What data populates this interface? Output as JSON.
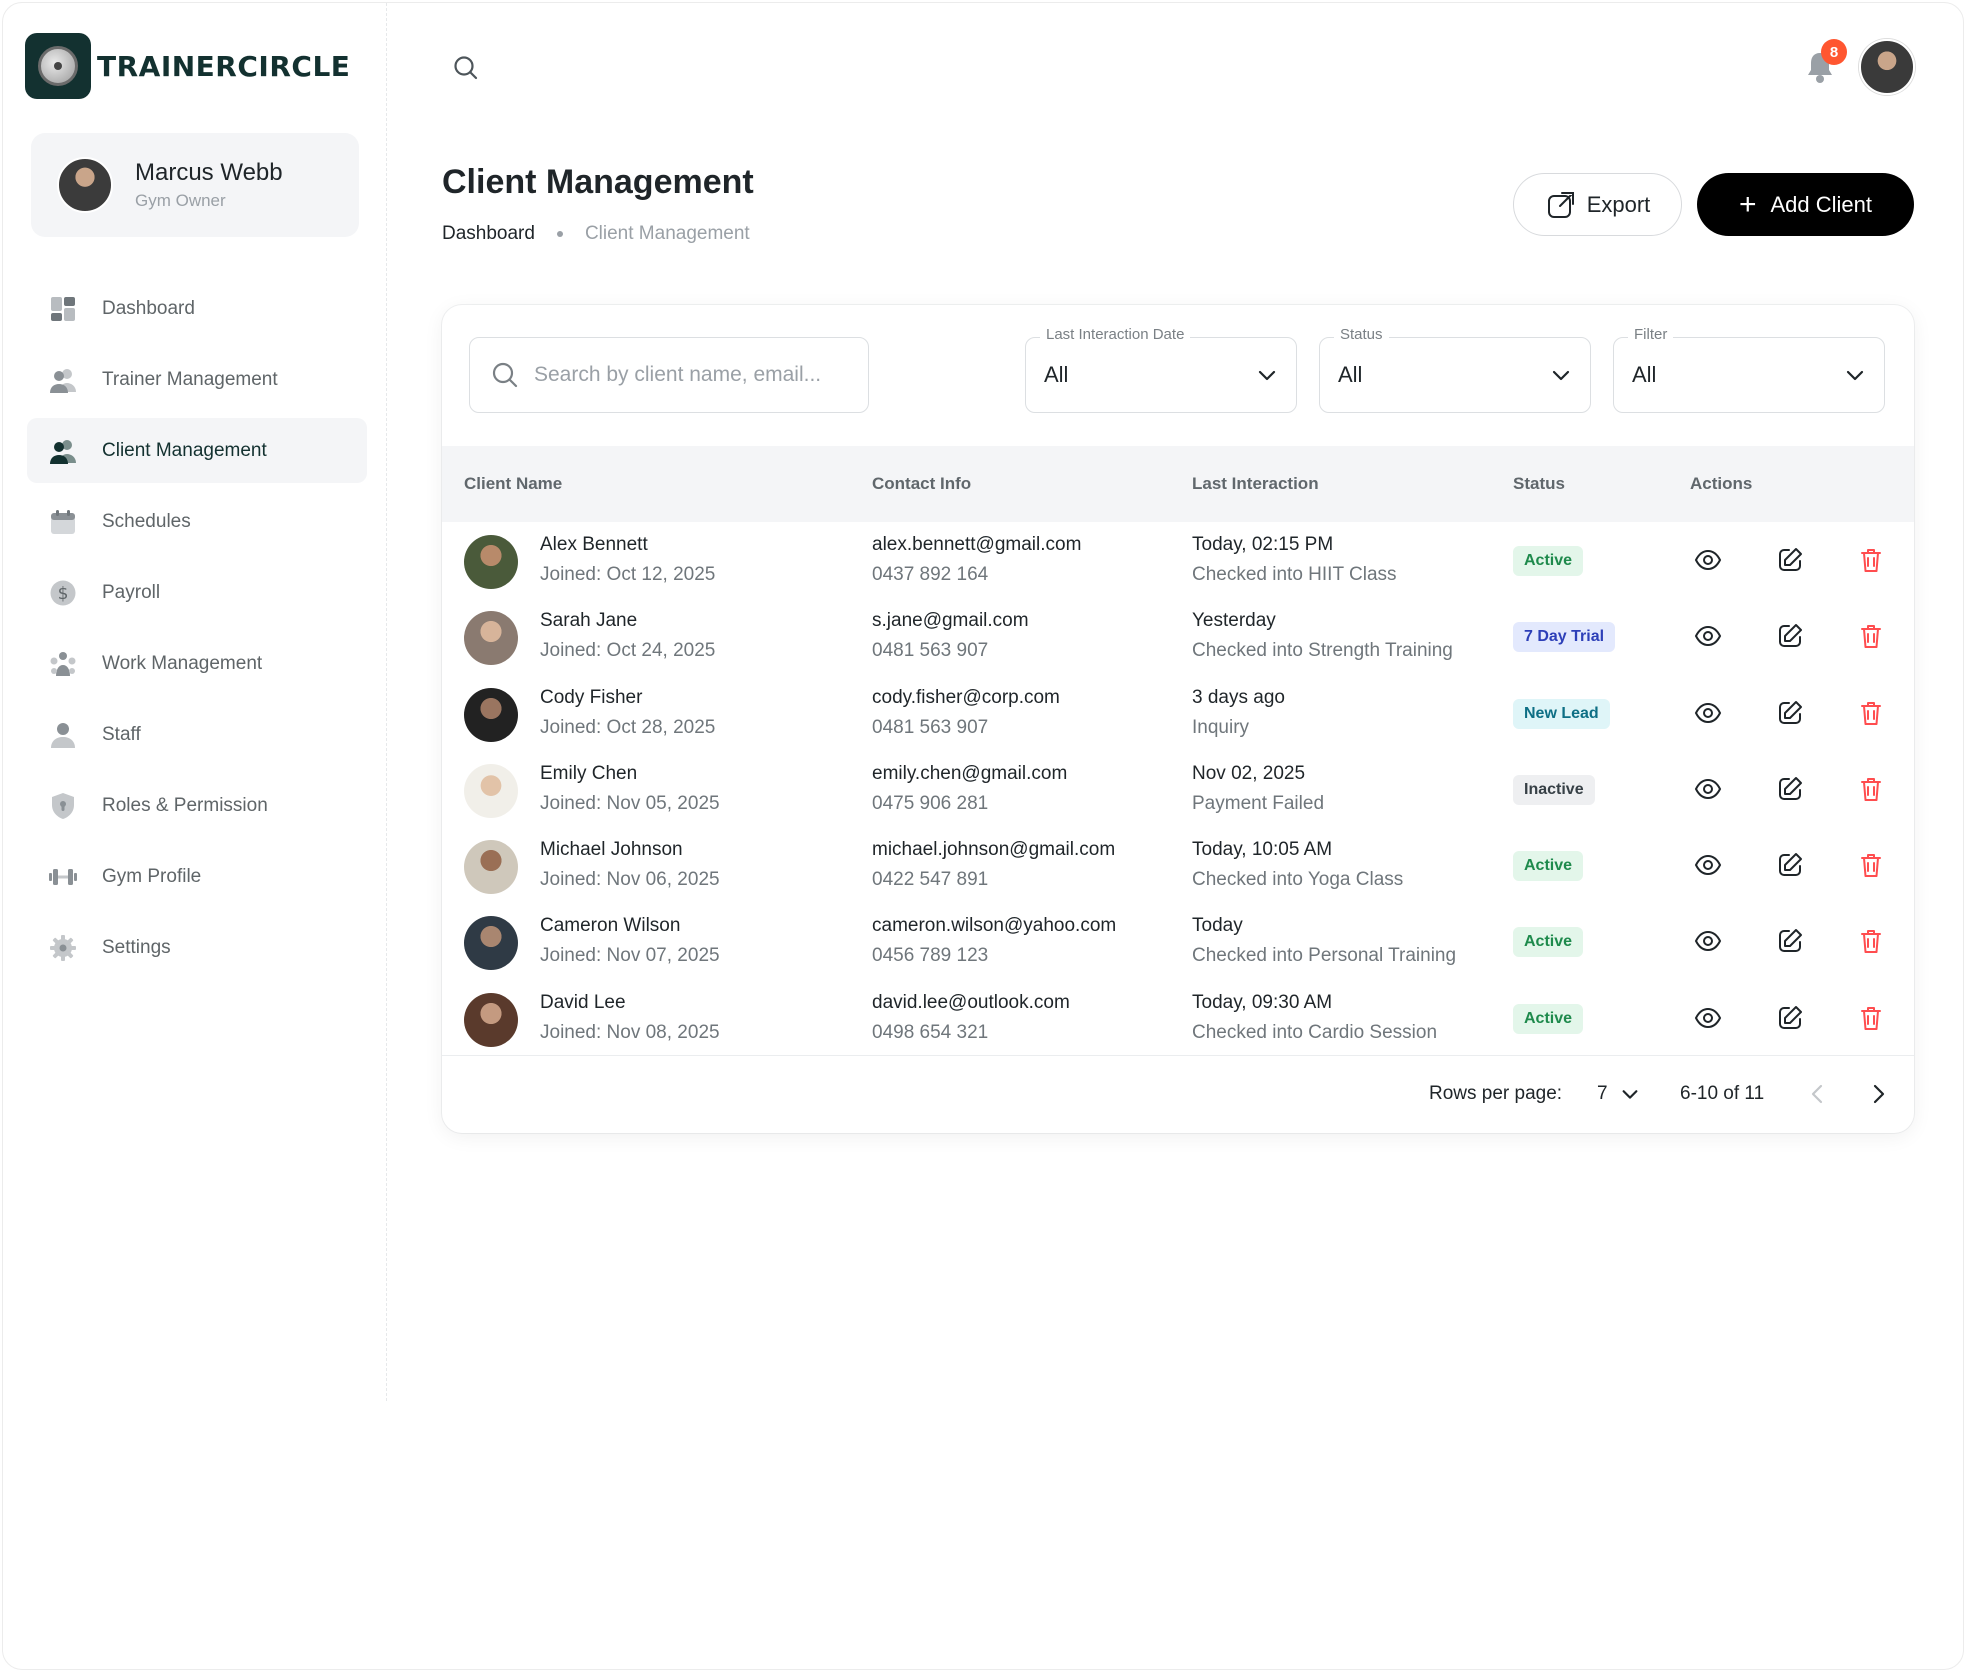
{
  "brand": {
    "name": "TRAINERCIRCLE"
  },
  "profile": {
    "name": "Marcus Webb",
    "role": "Gym Owner"
  },
  "nav": [
    {
      "label": "Dashboard",
      "icon": "dashboard-icon"
    },
    {
      "label": "Trainer Management",
      "icon": "trainers-icon"
    },
    {
      "label": "Client Management",
      "icon": "clients-icon"
    },
    {
      "label": "Schedules",
      "icon": "calendar-icon"
    },
    {
      "label": "Payroll",
      "icon": "dollar-icon"
    },
    {
      "label": "Work Management",
      "icon": "work-icon"
    },
    {
      "label": "Staff",
      "icon": "person-icon"
    },
    {
      "label": "Roles & Permission",
      "icon": "shield-icon"
    },
    {
      "label": "Gym Profile",
      "icon": "dumbbell-icon"
    },
    {
      "label": "Settings",
      "icon": "gear-icon"
    }
  ],
  "header": {
    "notification_count": "8"
  },
  "page": {
    "title": "Client Management",
    "breadcrumb": {
      "home": "Dashboard",
      "current": "Client Management"
    },
    "export_label": "Export",
    "add_label": "Add Client"
  },
  "filters": {
    "search_placeholder": "Search by client name, email...",
    "last_interaction": {
      "label": "Last Interaction Date",
      "value": "All"
    },
    "status": {
      "label": "Status",
      "value": "All"
    },
    "filter": {
      "label": "Filter",
      "value": "All"
    }
  },
  "table": {
    "columns": [
      "Client Name",
      "Contact Info",
      "Last Interaction",
      "Status",
      "Actions"
    ],
    "rows": [
      {
        "name": "Alex Bennett",
        "joined": "Joined: Oct 12, 2025",
        "email": "alex.bennett@gmail.com",
        "phone": "0437 892 164",
        "interaction": "Today, 02:15 PM",
        "detail": "Checked into HIIT Class",
        "status": "Active"
      },
      {
        "name": "Sarah Jane",
        "joined": "Joined: Oct 24, 2025",
        "email": "s.jane@gmail.com",
        "phone": "0481 563 907",
        "interaction": "Yesterday",
        "detail": "Checked into Strength Training",
        "status": "7 Day Trial"
      },
      {
        "name": "Cody Fisher",
        "joined": "Joined: Oct 28, 2025",
        "email": "cody.fisher@corp.com",
        "phone": "0481 563 907",
        "interaction": "3 days ago",
        "detail": "Inquiry",
        "status": "New Lead"
      },
      {
        "name": "Emily Chen",
        "joined": "Joined: Nov 05, 2025",
        "email": "emily.chen@gmail.com",
        "phone": "0475 906 281",
        "interaction": "Nov 02, 2025",
        "detail": "Payment Failed",
        "status": "Inactive"
      },
      {
        "name": "Michael Johnson",
        "joined": "Joined: Nov 06, 2025",
        "email": "michael.johnson@gmail.com",
        "phone": "0422 547 891",
        "interaction": "Today, 10:05 AM",
        "detail": "Checked into Yoga Class",
        "status": "Active"
      },
      {
        "name": "Cameron Wilson",
        "joined": "Joined: Nov 07, 2025",
        "email": "cameron.wilson@yahoo.com",
        "phone": "0456 789 123",
        "interaction": "Today",
        "detail": "Checked into Personal Training",
        "status": "Active"
      },
      {
        "name": "David Lee",
        "joined": "Joined: Nov 08, 2025",
        "email": "david.lee@outlook.com",
        "phone": "0498 654 321",
        "interaction": "Today, 09:30 AM",
        "detail": "Checked into Cardio Session",
        "status": "Active"
      }
    ]
  },
  "pagination": {
    "rows_label": "Rows per page:",
    "rows_value": "7",
    "range": "6-10 of 11"
  },
  "colors": {
    "brand": "#133130",
    "badge_active_bg": "#e3f6ea",
    "badge_active_fg": "#1e8a4c",
    "badge_trial_bg": "#e3e9fd",
    "badge_trial_fg": "#2d3fb8",
    "badge_lead_bg": "#dff5f8",
    "badge_lead_fg": "#0e6f85",
    "badge_inactive_bg": "#eeeff1",
    "badge_inactive_fg": "#374046",
    "delete": "#ff4d4f",
    "notification": "#ff5630"
  }
}
